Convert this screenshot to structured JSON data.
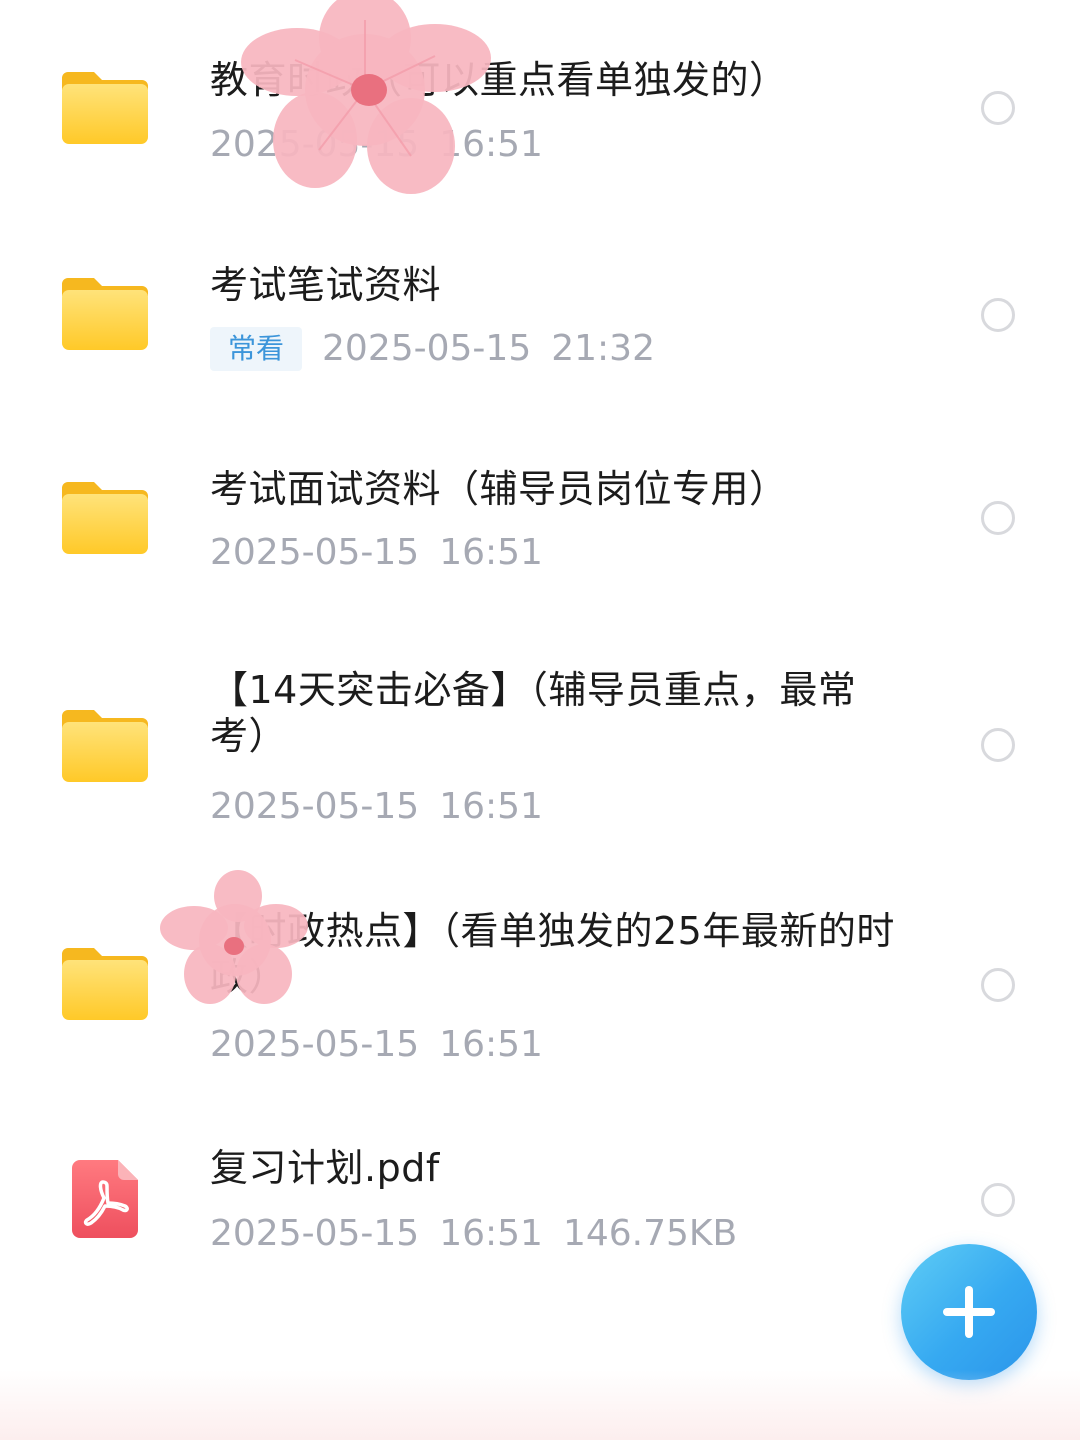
{
  "files": [
    {
      "name": "教育时政（可以重点看单独发的）",
      "date": "2025-05-15",
      "time": "16:51",
      "tag": "",
      "size": "",
      "type": "folder"
    },
    {
      "name": "考试笔试资料",
      "date": "2025-05-15",
      "time": "21:32",
      "tag": "常看",
      "size": "",
      "type": "folder"
    },
    {
      "name": "考试面试资料（辅导员岗位专用）",
      "date": "2025-05-15",
      "time": "16:51",
      "tag": "",
      "size": "",
      "type": "folder"
    },
    {
      "name": "【14天突击必备】（辅导员重点，最常考）",
      "date": "2025-05-15",
      "time": "16:51",
      "tag": "",
      "size": "",
      "type": "folder"
    },
    {
      "name": "【时政热点】（看单独发的25年最新的时政）",
      "date": "2025-05-15",
      "time": "16:51",
      "tag": "",
      "size": "",
      "type": "folder"
    },
    {
      "name": "复习计划.pdf",
      "date": "2025-05-15",
      "time": "16:51",
      "tag": "",
      "size": "146.75KB",
      "type": "pdf"
    }
  ],
  "icons": {
    "folder": "folder-icon",
    "pdf": "pdf-icon",
    "select": "radio-circle-icon",
    "add": "plus-icon"
  },
  "colors": {
    "folder": "#FFD84D",
    "pdf": "#F25B67",
    "tag_text": "#3C95DA",
    "tag_bg": "#EEF5FB",
    "meta_text": "#A6A9B3",
    "fab": "#36A9F1"
  }
}
